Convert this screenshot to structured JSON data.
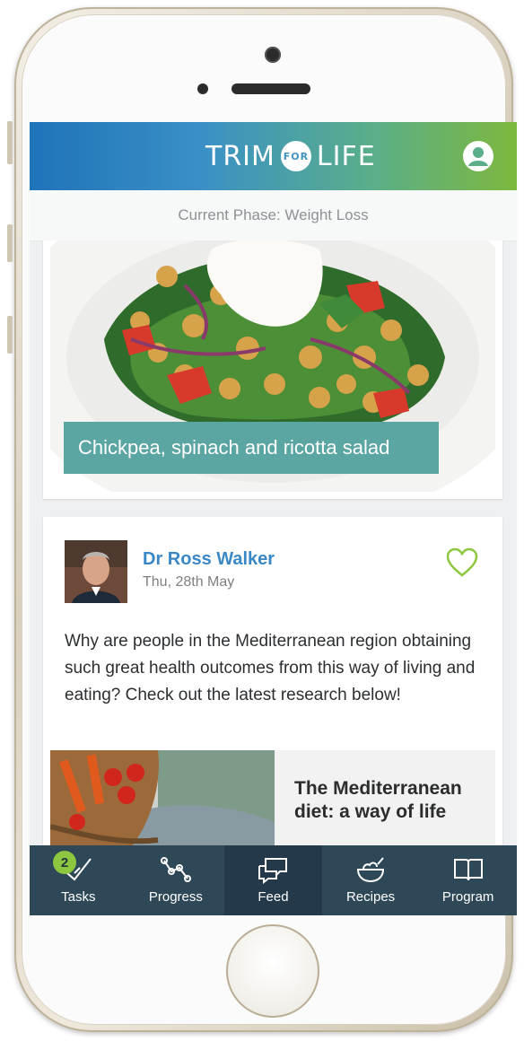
{
  "app": {
    "logo_left": "TRIM",
    "logo_badge": "FOR",
    "logo_right": "LIFE"
  },
  "phase": {
    "text": "Current Phase: Weight Loss"
  },
  "feed": {
    "recipe_card": {
      "caption": "Chickpea, spinach and ricotta salad"
    },
    "post": {
      "author": "Dr Ross Walker",
      "date": "Thu, 28th May",
      "body": "Why are people in the Mediterranean region obtaining such great health outcomes from this way of living and eating?  Check out the latest research below!",
      "article_title": "The Mediterranean diet: a way of life"
    }
  },
  "tabs": [
    {
      "label": "Tasks",
      "icon": "tasks-check-icon",
      "badge": "2"
    },
    {
      "label": "Progress",
      "icon": "progress-graph-icon"
    },
    {
      "label": "Feed",
      "icon": "chat-bubbles-icon",
      "active": true
    },
    {
      "label": "Recipes",
      "icon": "bowl-icon"
    },
    {
      "label": "Program",
      "icon": "book-icon"
    }
  ],
  "colors": {
    "header_start": "#1f73b9",
    "header_end": "#7db83d",
    "caption_bg": "#5ba5a3",
    "author": "#3a88c6",
    "tabbar": "#2e4858",
    "badge": "#8dc63f"
  }
}
